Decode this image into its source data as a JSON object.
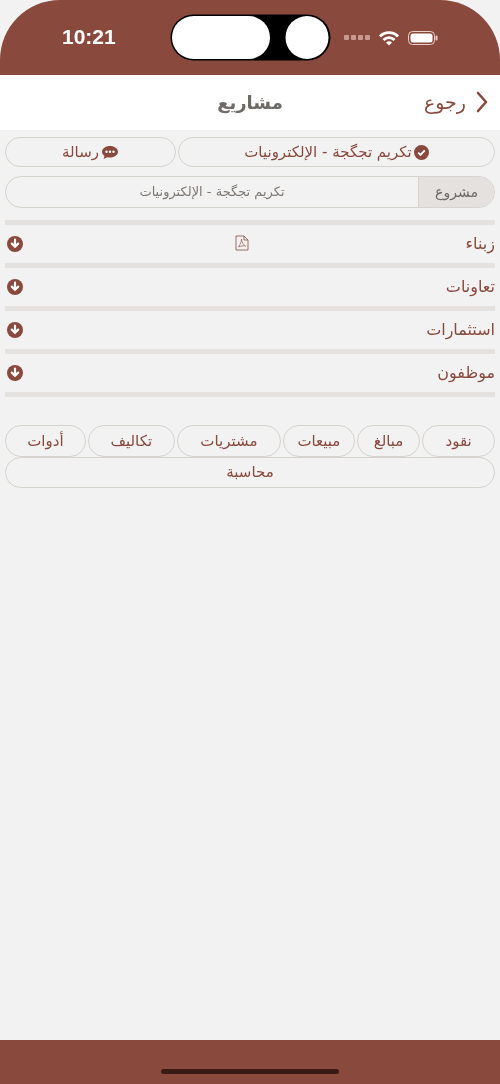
{
  "status_bar": {
    "time": "10:21"
  },
  "nav": {
    "back": "رجوع",
    "title": "مشاريع"
  },
  "project_button": {
    "label": "تكريم تجگجة - الإلكترونيات"
  },
  "message_button": {
    "label": "رسالة"
  },
  "project_field": {
    "label": "مشروع",
    "value": "تكريم تجگجة - الإلكترونيات"
  },
  "sections": [
    {
      "label": "زبناء",
      "has_pdf": true
    },
    {
      "label": "تعاونات",
      "has_pdf": false
    },
    {
      "label": "استثمارات",
      "has_pdf": false
    },
    {
      "label": "موظفون",
      "has_pdf": false
    }
  ],
  "tabs": [
    {
      "label": "نقود"
    },
    {
      "label": "مبالغ"
    },
    {
      "label": "مبيعات"
    },
    {
      "label": "مشتريات"
    },
    {
      "label": "تكاليف"
    },
    {
      "label": "أدوات"
    }
  ],
  "accounting_button": {
    "label": "محاسبة"
  }
}
